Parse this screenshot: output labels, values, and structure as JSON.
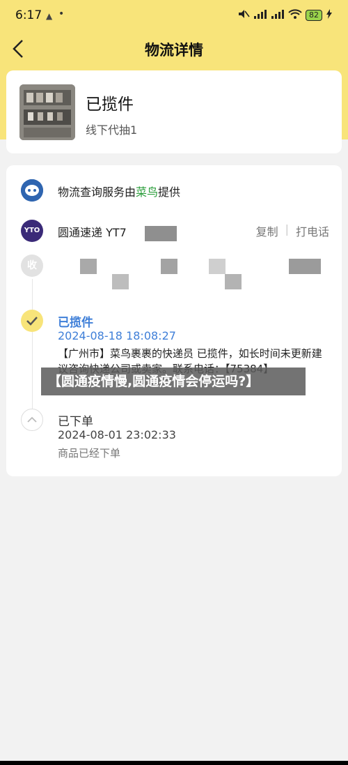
{
  "status_bar": {
    "time": "6:17",
    "icons": [
      "notification-icon",
      "dot-icon",
      "mute-icon",
      "signal-icon",
      "signal-icon",
      "wifi-icon",
      "battery-icon",
      "charging-icon"
    ],
    "battery": "82"
  },
  "header": {
    "back_icon": "chevron-left-icon",
    "title": "物流详情"
  },
  "package": {
    "status": "已揽件",
    "subtitle": "线下代抽1"
  },
  "logistics": {
    "provider_prefix": "物流查询服务由",
    "provider_name": "菜鸟",
    "provider_suffix": "提供",
    "carrier_name": "圆通速递 YT7",
    "copy_label": "复制",
    "call_label": "打电话",
    "collapse_label": "收",
    "carrier_badge": "YTO"
  },
  "timeline": [
    {
      "title": "已揽件",
      "time": "2024-08-18 18:08:27",
      "description": "【广州市】菜鸟裹裹的快递员              已揽件，如长时间未更新建议咨询快递公司或卖家。联系电话：【75384】"
    },
    {
      "title": "已下单",
      "time": "2024-08-01 23:02:33",
      "description": "商品已经下单"
    }
  ],
  "overlay": {
    "caption": "【圆通疫情慢,圆通疫情会停运吗?】"
  },
  "colors": {
    "header_bg": "#f8e47a",
    "accent_blue": "#3f7fd8",
    "provider_green": "#2a9d3a"
  }
}
